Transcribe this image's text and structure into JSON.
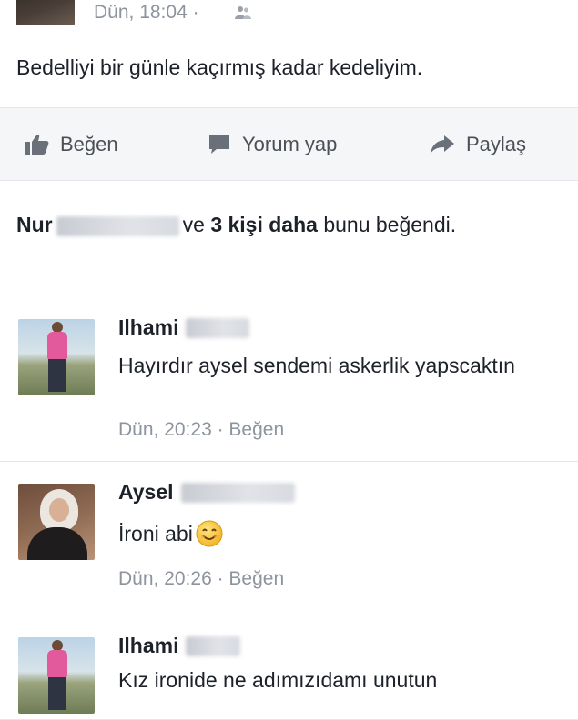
{
  "post": {
    "time": "Dün, 18:04 ·",
    "audience_icon": "friends-icon",
    "text": "Bedelliyi bir günle kaçırmış kadar kedeliyim."
  },
  "actions": {
    "like_label": "Beğen",
    "comment_label": "Yorum yap",
    "share_label": "Paylaş"
  },
  "likes": {
    "name": "Nur",
    "middle": "ve",
    "others": "3 kişi daha",
    "suffix": "bunu beğendi."
  },
  "comments": [
    {
      "author": "Ilhami",
      "text": "Hayırdır aysel sendemi askerlik yapscaktın",
      "time": "Dün, 20:23 ·",
      "like_label": "Beğen"
    },
    {
      "author": "Aysel",
      "text": "İroni abi",
      "emoji": "smiley-icon",
      "time": "Dün, 20:26 ·",
      "like_label": "Beğen"
    },
    {
      "author": "Ilhami",
      "text": "Kız ironide ne adımızıdamı unutun"
    }
  ],
  "colors": {
    "text": "#1d2129",
    "meta": "#8d949e",
    "action": "#4b4f56",
    "background": "#f7f7f9"
  }
}
